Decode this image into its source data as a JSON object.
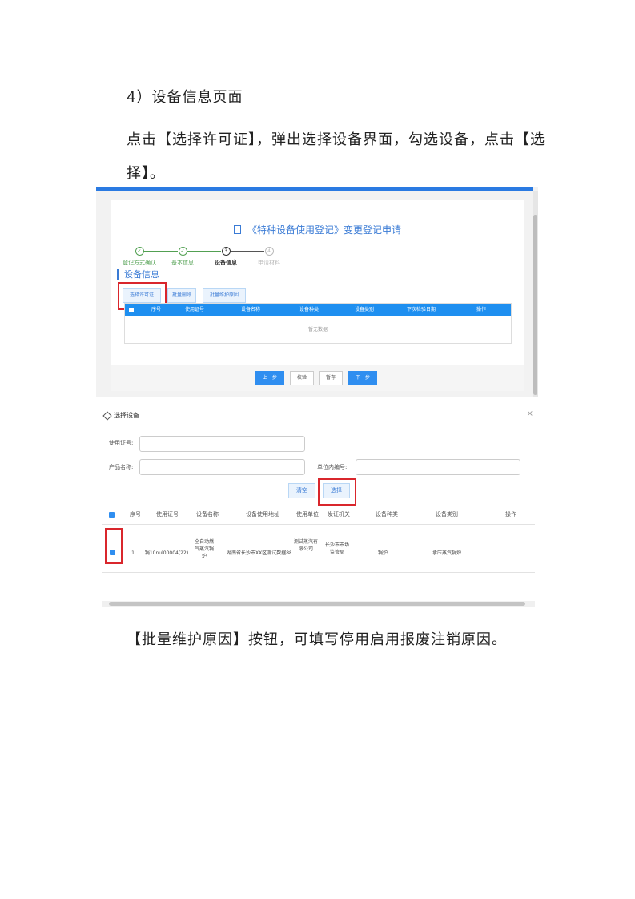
{
  "doc": {
    "heading": "4）设备信息页面",
    "para1_line1": "点击【选择许可证】，弹出选择设备界面，勾选设备，点击【选",
    "para1_line2": "择】。",
    "para2": "【批量维护原因】按钮，可填写停用启用报废注销原因。"
  },
  "screen1": {
    "title": "《特种设备使用登记》变更登记申请",
    "steps": [
      {
        "num": "✓",
        "label": "登记方式确认"
      },
      {
        "num": "✓",
        "label": "基本信息"
      },
      {
        "num": "3",
        "label": "设备信息"
      },
      {
        "num": "4",
        "label": "申请材料"
      }
    ],
    "section_title": "设备信息",
    "buttons": [
      "选择许可证",
      "批量删除",
      "批量维护原因"
    ],
    "columns": [
      "序号",
      "使用证号",
      "设备名称",
      "设备种类",
      "设备类别",
      "下次检验日期",
      "操作"
    ],
    "empty_text": "暂无数据",
    "footer_buttons": [
      "上一步",
      "校验",
      "暂存",
      "下一步"
    ]
  },
  "screen2": {
    "title": "选择设备",
    "close": "×",
    "fields": [
      {
        "label": "使用证号:"
      },
      {
        "label": "产品名称:"
      },
      {
        "label": "单位内编号:"
      }
    ],
    "buttons": {
      "clear": "清空",
      "select": "选择"
    },
    "columns": [
      "序号",
      "使用证号",
      "设备名称",
      "设备使用地址",
      "使用单位",
      "发证机关",
      "设备种类",
      "设备类别",
      "操作"
    ],
    "rows": [
      {
        "index": "1",
        "cert": "锅10nul00004(22)",
        "name": "全自动燃气蒸汽锅炉",
        "address": "湖南省长沙市XX区测试数据88号",
        "unit": "测试蒸汽有限公司",
        "authority": "长沙市市场监管局",
        "kind": "锅炉",
        "category": "承压蒸汽锅炉"
      }
    ]
  }
}
